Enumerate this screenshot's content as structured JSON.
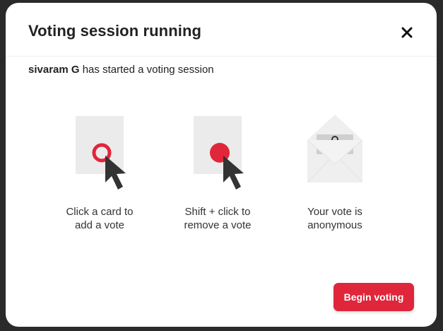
{
  "dialog": {
    "title": "Voting session running",
    "close_label": "×",
    "subtitle_user": "sivaram G",
    "subtitle_rest": " has started a voting session",
    "steps": [
      {
        "icon": "card-click-icon",
        "caption_line1": "Click a card to",
        "caption_line2": "add a vote"
      },
      {
        "icon": "card-shift-click-icon",
        "caption_line1": "Shift + click to",
        "caption_line2": "remove a vote"
      },
      {
        "icon": "locked-envelope-icon",
        "caption_line1": "Your vote is",
        "caption_line2": "anonymous"
      }
    ],
    "primary_button_label": "Begin voting"
  },
  "colors": {
    "accent": "#e0263a",
    "card": "#ebebeb",
    "cursor": "#333333"
  }
}
